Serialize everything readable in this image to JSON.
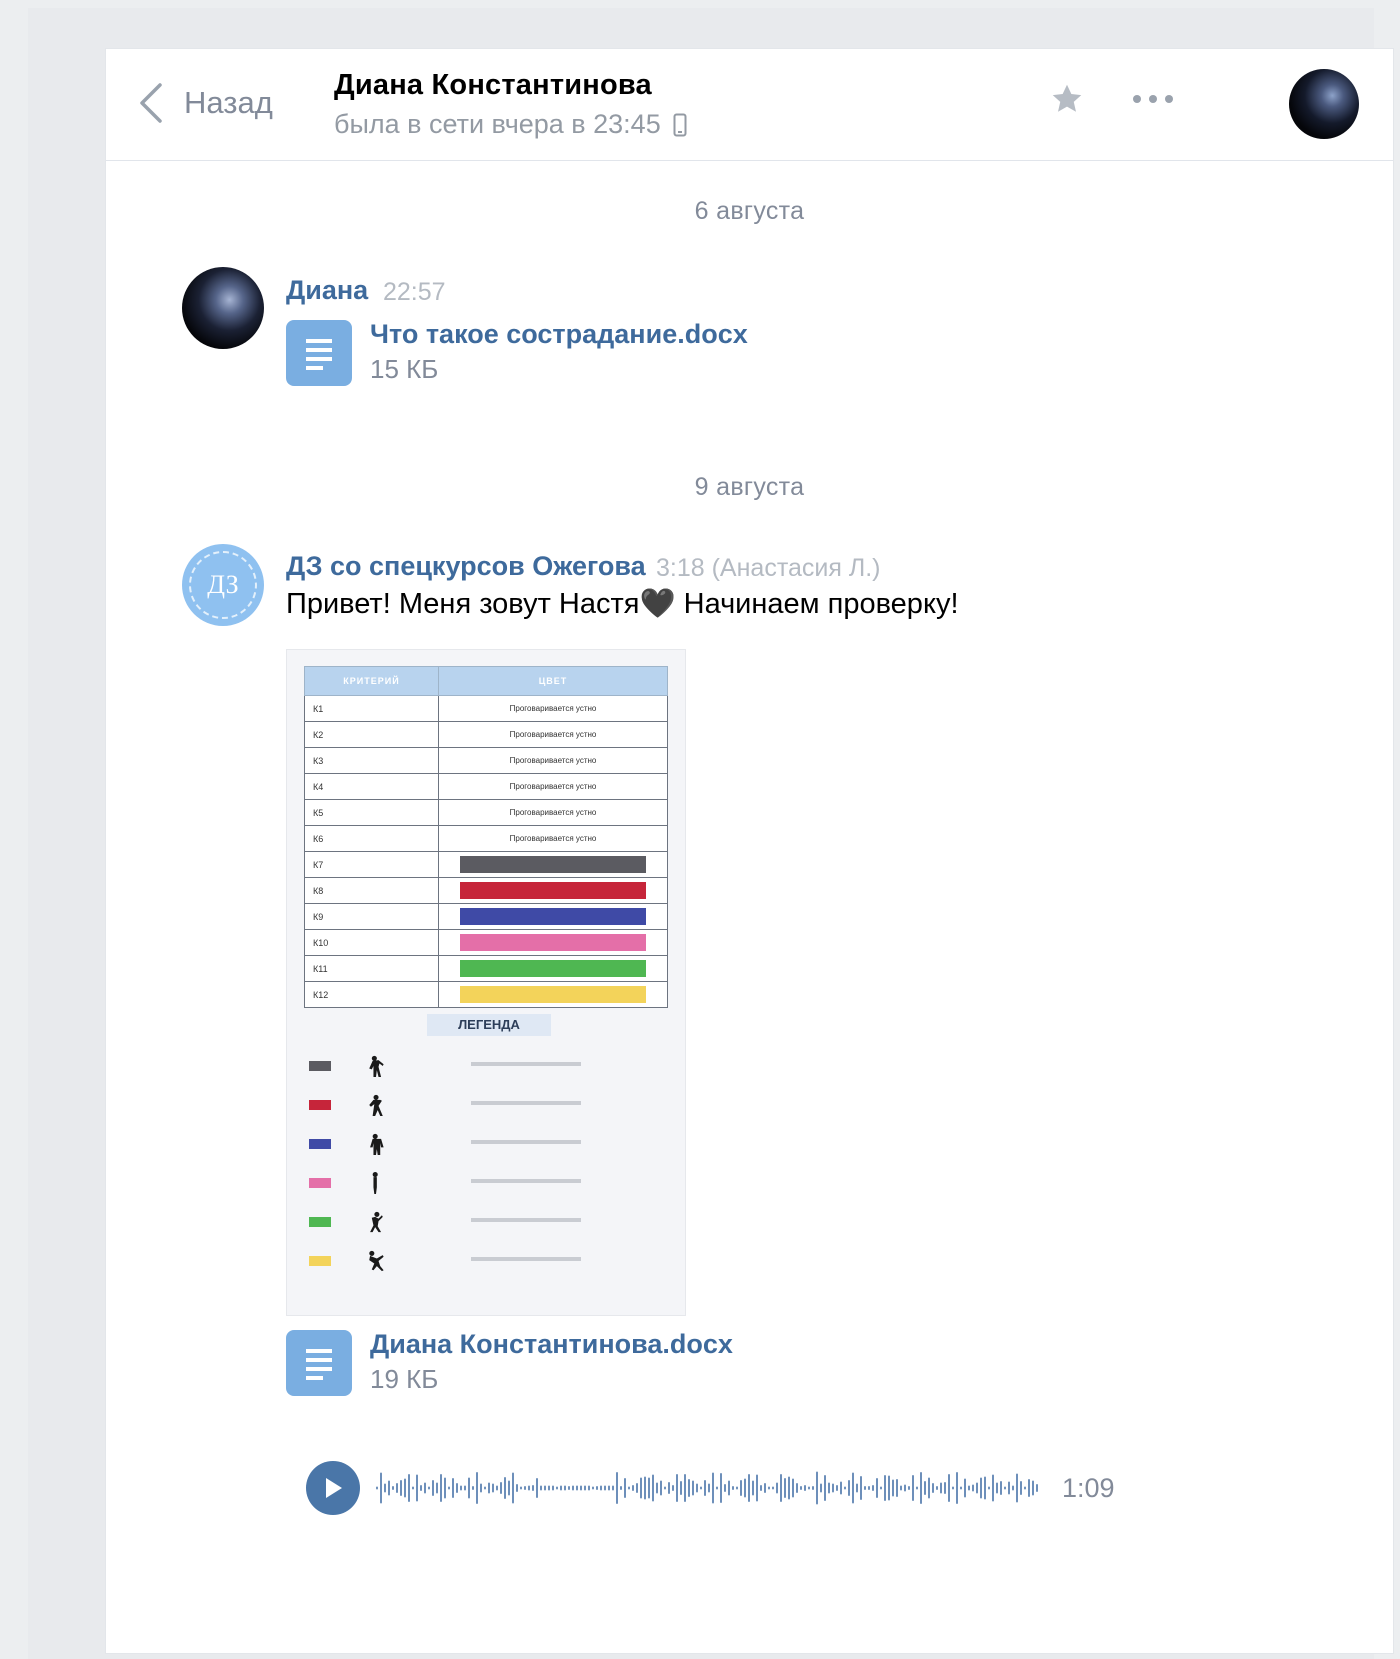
{
  "header": {
    "back_label": "Назад",
    "name": "Диана Константинова",
    "status": "была в сети вчера в 23:45"
  },
  "dates": [
    "6 августа",
    "9 августа"
  ],
  "messages": [
    {
      "author": "Диана",
      "time": "22:57",
      "doc": {
        "name": "Что такое сострадание.docx",
        "size": "15 КБ"
      }
    },
    {
      "author": "ДЗ со спецкурсов Ожегова",
      "time": "3:18 (Анастасия Л.)",
      "avatar_text": "ДЗ",
      "text": "Привет! Меня зовут Настя🖤 Начинаем проверку!",
      "photo": {
        "table_headers": [
          "КРИТЕРИЙ",
          "ЦВЕТ"
        ],
        "rows": [
          {
            "k": "К1",
            "v": "Проговаривается устно"
          },
          {
            "k": "К2",
            "v": "Проговаривается устно"
          },
          {
            "k": "К3",
            "v": "Проговаривается устно"
          },
          {
            "k": "К4",
            "v": "Проговаривается устно"
          },
          {
            "k": "К5",
            "v": "Проговаривается устно"
          },
          {
            "k": "К6",
            "v": "Проговаривается устно"
          },
          {
            "k": "К7",
            "v": ""
          },
          {
            "k": "К8",
            "v": ""
          },
          {
            "k": "К9",
            "v": ""
          },
          {
            "k": "К10",
            "v": ""
          },
          {
            "k": "К11",
            "v": ""
          },
          {
            "k": "К12",
            "v": ""
          }
        ],
        "swatch_colors": [
          "#5b5b61",
          "#c6253a",
          "#3f4aa6",
          "#e46fa8",
          "#4fb752",
          "#f3d35a"
        ],
        "legend_title": "ЛЕГЕНДА"
      },
      "doc": {
        "name": "Диана Константинова.docx",
        "size": "19 КБ"
      },
      "voice": {
        "duration": "1:09"
      }
    }
  ],
  "colors": {
    "accent": "#4a76a8",
    "link": "#3e6a9c",
    "muted": "#828a99"
  },
  "icons": [
    "chevron-left-icon",
    "phone-icon",
    "star-icon",
    "more-icon",
    "document-icon",
    "play-icon",
    "waveform-icon"
  ]
}
